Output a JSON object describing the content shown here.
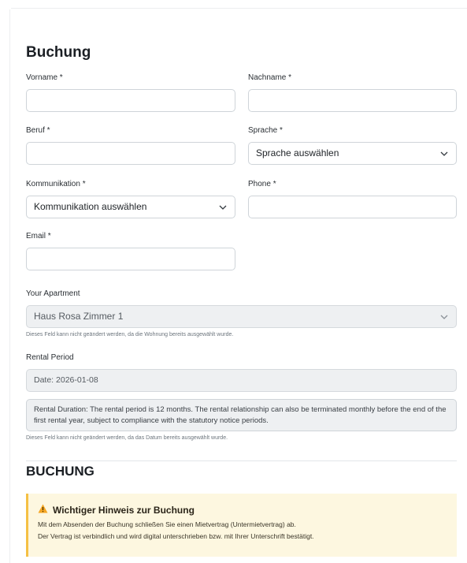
{
  "form": {
    "title": "Buchung",
    "vorname_label": "Vorname *",
    "vorname_value": "",
    "nachname_label": "Nachname *",
    "nachname_value": "",
    "beruf_label": "Beruf *",
    "beruf_value": "",
    "sprache_label": "Sprache *",
    "sprache_selected": "Sprache auswählen",
    "kommunikation_label": "Kommunikation *",
    "kommunikation_selected": "Kommunikation auswählen",
    "phone_label": "Phone *",
    "phone_value": "",
    "email_label": "Email *",
    "email_value": ""
  },
  "apartment": {
    "label": "Your Apartment",
    "selected": "Haus Rosa Zimmer 1",
    "help": "Dieses Feld kann nicht geändert werden, da die Wohnung bereits ausgewählt wurde."
  },
  "rental": {
    "label": "Rental Period",
    "date": "Date: 2026-01-08",
    "duration": "Rental Duration: The rental period is 12 months. The rental relationship can also be terminated monthly before the end of the first rental year, subject to compliance with the statutory notice periods.",
    "help": "Dieses Feld kann nicht geändert werden, da das Datum bereits ausgewählt wurde."
  },
  "section2": {
    "title": "BUCHUNG"
  },
  "notice": {
    "icon": "warning-icon",
    "title": "Wichtiger Hinweis zur Buchung",
    "line1": "Mit dem Absenden der Buchung schließen Sie einen Mietvertrag (Untermietvertrag) ab.",
    "line2": "Der Vertrag ist verbindlich und wird digital unterschrieben bzw. mit Ihrer Unterschrift bestätigt."
  },
  "colors": {
    "notice_bg": "#fdf7e0",
    "notice_border": "#f5c044",
    "disabled_bg": "#eef0f2"
  }
}
